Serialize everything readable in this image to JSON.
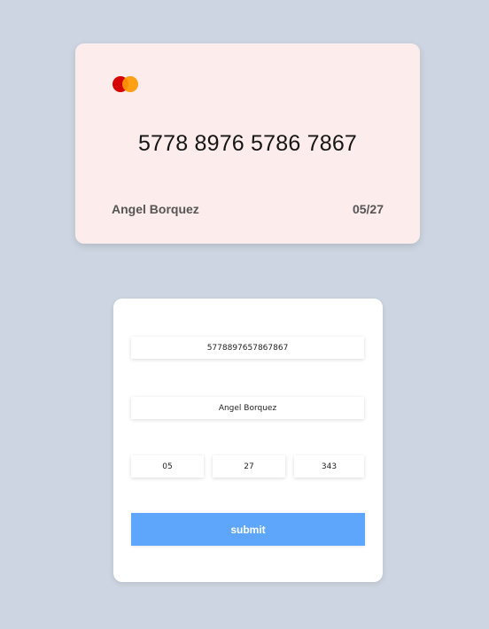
{
  "card": {
    "brand_icon": "mastercard-logo-icon",
    "number": "5778 8976 5786 7867",
    "holder": "Angel Borquez",
    "expiry": "05/27"
  },
  "form": {
    "card_number_value": "5778897657867867",
    "holder_name_value": "Angel Borquez",
    "expiry_month_value": "05",
    "expiry_year_value": "27",
    "cvv_value": "343",
    "submit_label": "submit"
  },
  "colors": {
    "background": "#ccd5e1",
    "card_background": "#fdecec",
    "submit_button": "#5ea6fb",
    "logo_red": "#d50000",
    "logo_orange": "#ff9800"
  }
}
